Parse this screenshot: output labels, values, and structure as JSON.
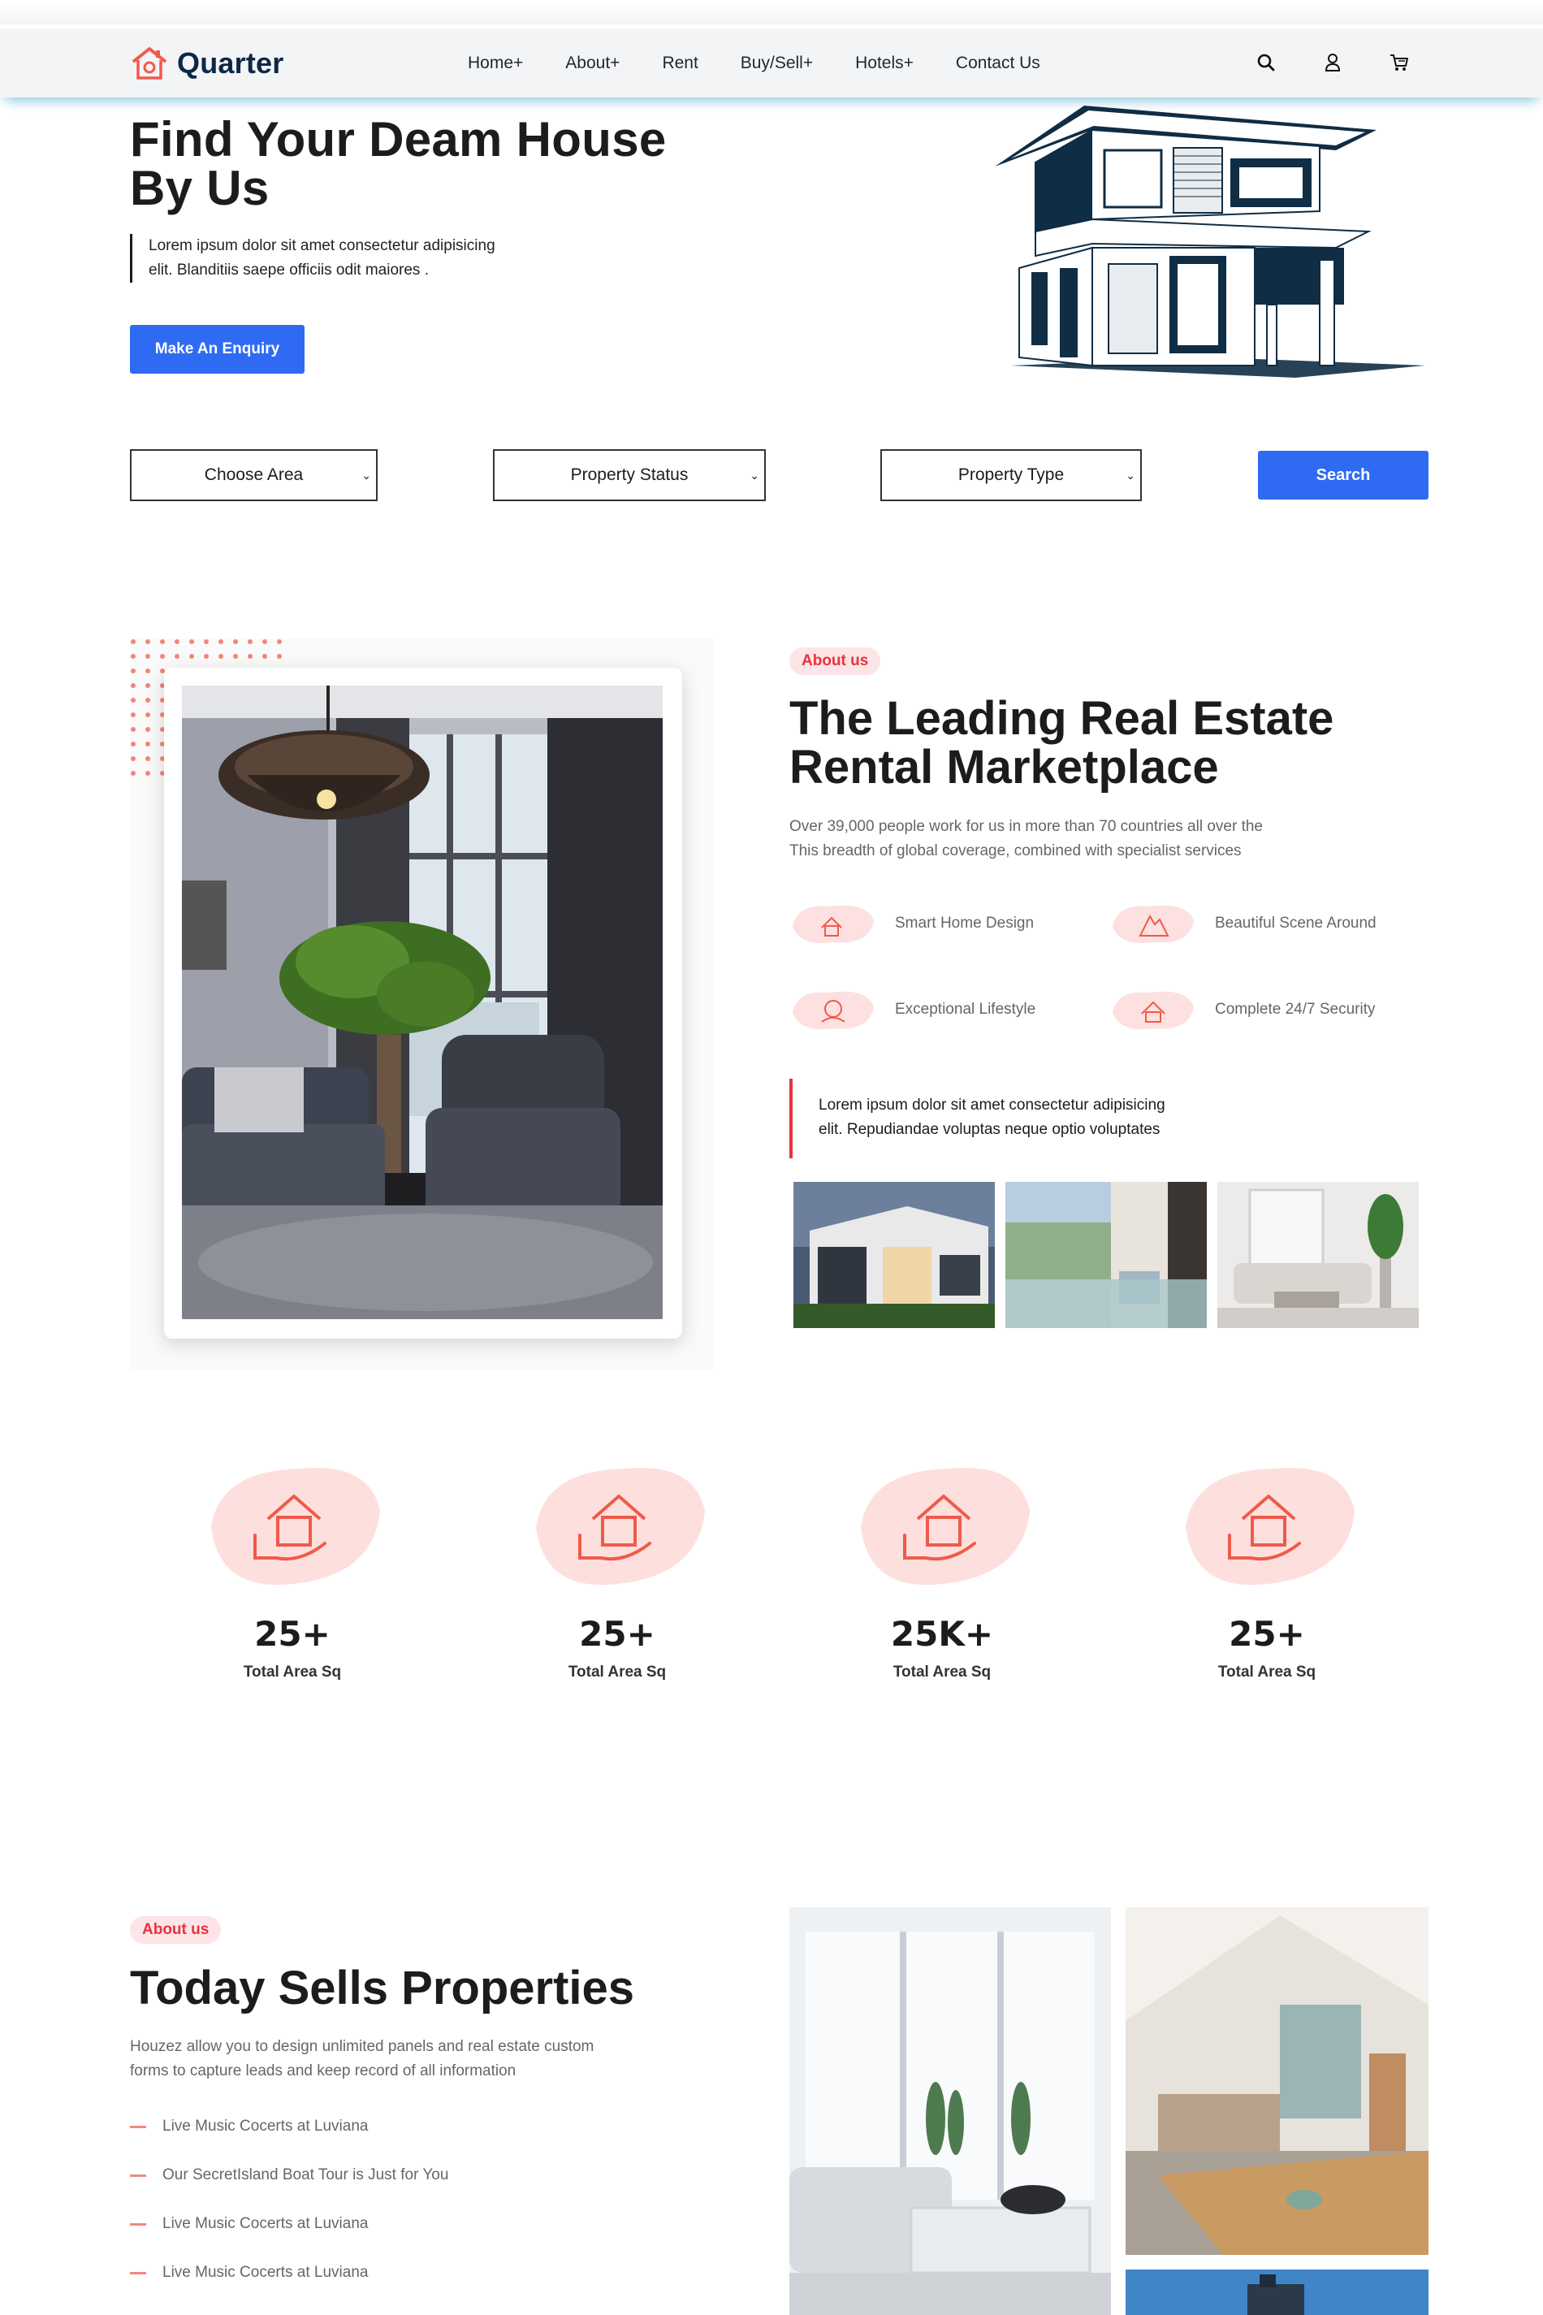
{
  "header": {
    "brand": "Quarter",
    "nav": [
      "Home+",
      "About+",
      "Rent",
      "Buy/Sell+",
      "Hotels+",
      "Contact Us"
    ],
    "icons": [
      "search-icon",
      "user-icon",
      "cart-icon"
    ]
  },
  "hero": {
    "title_line1": "Find Your Deam House",
    "title_line2": "By Us",
    "text_line1": "Lorem ipsum dolor sit amet consectetur adipisicing",
    "text_line2": "elit. Blanditiis saepe officiis odit maiores .",
    "cta": "Make An Enquiry"
  },
  "filters": {
    "area": "Choose Area",
    "status": "Property Status",
    "type": "Property Type",
    "search": "Search"
  },
  "about": {
    "pill": "About us",
    "title_line1": "The Leading Real Estate",
    "title_line2": "Rental Marketplace",
    "text_line1": "Over 39,000 people work for us in more than 70 countries all over the",
    "text_line2": "This breadth of global coverage, combined with specialist services",
    "features": [
      "Smart Home Design",
      "Beautiful Scene Around",
      "Exceptional Lifestyle",
      "Complete 24/7 Security"
    ],
    "quote_line1": "Lorem ipsum dolor sit amet consectetur adipisicing",
    "quote_line2": "elit. Repudiandae voluptas neque optio voluptates"
  },
  "stats": [
    {
      "value": "25+",
      "label": "Total Area Sq"
    },
    {
      "value": "25+",
      "label": "Total Area Sq"
    },
    {
      "value": "25K+",
      "label": "Total Area Sq"
    },
    {
      "value": "25+",
      "label": "Total Area Sq"
    }
  ],
  "sells": {
    "pill": "About us",
    "title": "Today Sells Properties",
    "text_line1": "Houzez allow you to design unlimited panels and real estate custom",
    "text_line2": "forms to capture leads and keep record of all information",
    "items": [
      "Live Music Cocerts at Luviana",
      "Our SecretIsland Boat Tour is Just for You",
      "Live Music Cocerts at Luviana",
      "Live Music Cocerts at Luviana"
    ]
  },
  "colors": {
    "primary": "#2f6bf2",
    "accent": "#e8333d",
    "brand_dark": "#0d2846",
    "soft_pink": "#fde4e6"
  }
}
